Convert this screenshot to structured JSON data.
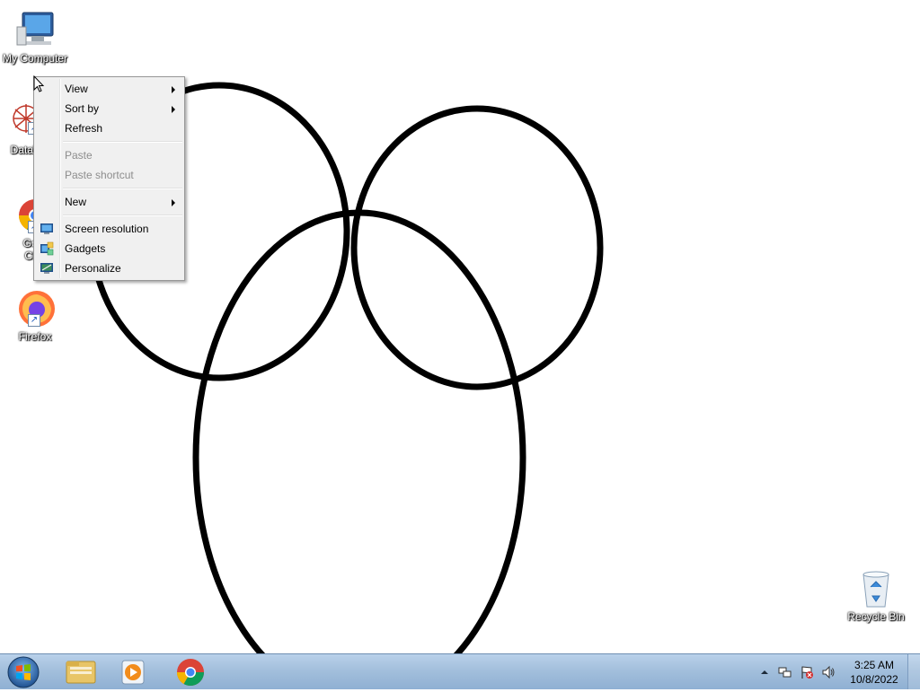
{
  "desktop": {
    "icons": [
      {
        "label": "My Computer",
        "glyph": "computer-icon"
      },
      {
        "label": "DataW",
        "glyph": "datawrangler-icon"
      },
      {
        "label": "Goo",
        "label2": "Chr",
        "glyph": "chrome-icon"
      },
      {
        "label": "Firefox",
        "glyph": "firefox-icon"
      },
      {
        "label": "Recycle Bin",
        "glyph": "recycle-bin-icon"
      }
    ]
  },
  "context_menu": {
    "items": [
      {
        "label": "View",
        "submenu": true,
        "enabled": true
      },
      {
        "label": "Sort by",
        "submenu": true,
        "enabled": true
      },
      {
        "label": "Refresh",
        "submenu": false,
        "enabled": true
      },
      {
        "label": "Paste",
        "submenu": false,
        "enabled": false
      },
      {
        "label": "Paste shortcut",
        "submenu": false,
        "enabled": false
      },
      {
        "label": "New",
        "submenu": true,
        "enabled": true
      },
      {
        "label": "Screen resolution",
        "icon": "screen-resolution-icon",
        "enabled": true
      },
      {
        "label": "Gadgets",
        "icon": "gadgets-icon",
        "enabled": true
      },
      {
        "label": "Personalize",
        "icon": "personalize-icon",
        "enabled": true
      }
    ]
  },
  "taskbar": {
    "apps": [
      {
        "name": "windows-explorer",
        "icon": "folder-icon"
      },
      {
        "name": "media-player",
        "icon": "media-player-icon"
      },
      {
        "name": "chrome",
        "icon": "chrome-icon"
      }
    ],
    "tray": {
      "time": "3:25 AM",
      "date": "10/8/2022"
    }
  },
  "colors": {
    "taskbar": "#a3bfdc",
    "menu_bg": "#f0f0f0",
    "desktop_bg": "#ffffff"
  }
}
